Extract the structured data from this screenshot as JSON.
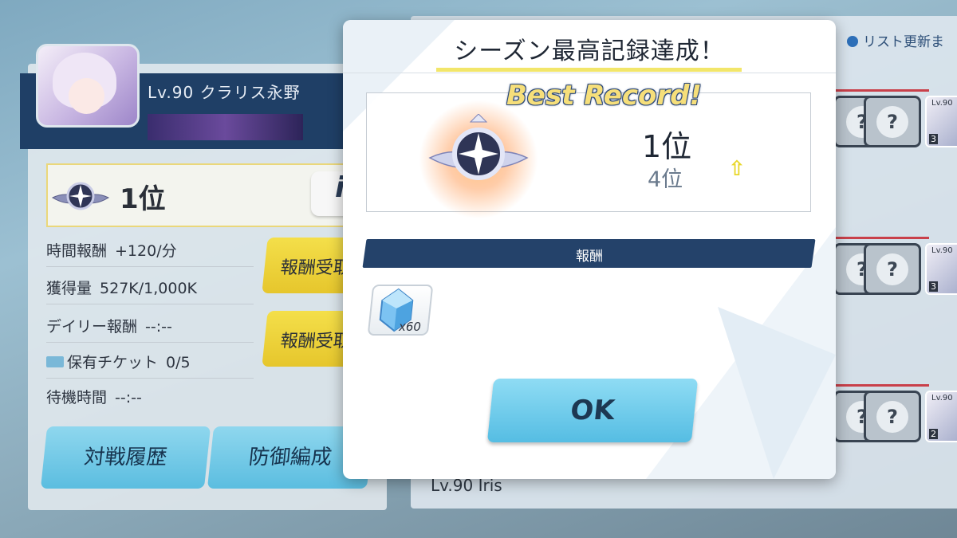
{
  "background_screen": {
    "player": {
      "level_name": "Lv.90 クラリス永野"
    },
    "rank": {
      "value": "1位",
      "info_icon_label": "i"
    },
    "stats": [
      {
        "label": "時間報酬",
        "value": "+120/分"
      },
      {
        "label": "獲得量",
        "value": "527K/1,000K"
      },
      {
        "label": "デイリー報酬",
        "value": "--:--"
      },
      {
        "label": "保有チケット",
        "value": "0/5"
      },
      {
        "label": "待機時間",
        "value": "--:--"
      }
    ],
    "receive_buttons": [
      "報酬受取",
      "報酬受取"
    ],
    "battle_history_button": "対戦履歴",
    "defense_formation_button": "防御編成",
    "list_update_label": "リスト更新ま",
    "opponent_cards": [
      {
        "portrait_level": "Lv.90",
        "portrait_number": "3"
      },
      {
        "portrait_level": "Lv.90",
        "portrait_number": "3"
      },
      {
        "portrait_level": "Lv.90",
        "portrait_number": "2"
      }
    ],
    "bottom_level_text": "Lv.90 Iris"
  },
  "modal": {
    "title": "シーズン最高記録達成！",
    "best_record_label": "Best Record!",
    "new_rank": "1位",
    "old_rank": "4位",
    "reward_header": "報酬",
    "reward_items": [
      {
        "icon": "crystal-gem-icon",
        "quantity": "x60"
      }
    ],
    "ok_button": "OK"
  },
  "colors": {
    "modal_background": "#ffffff",
    "title_underline": "#f2e66a",
    "reward_bar": "#24426a",
    "ok_button": "#55bde3",
    "receive_button": "#e6c62c",
    "best_record_text": "#f6df7a",
    "up_arrow": "#e8d72a"
  }
}
